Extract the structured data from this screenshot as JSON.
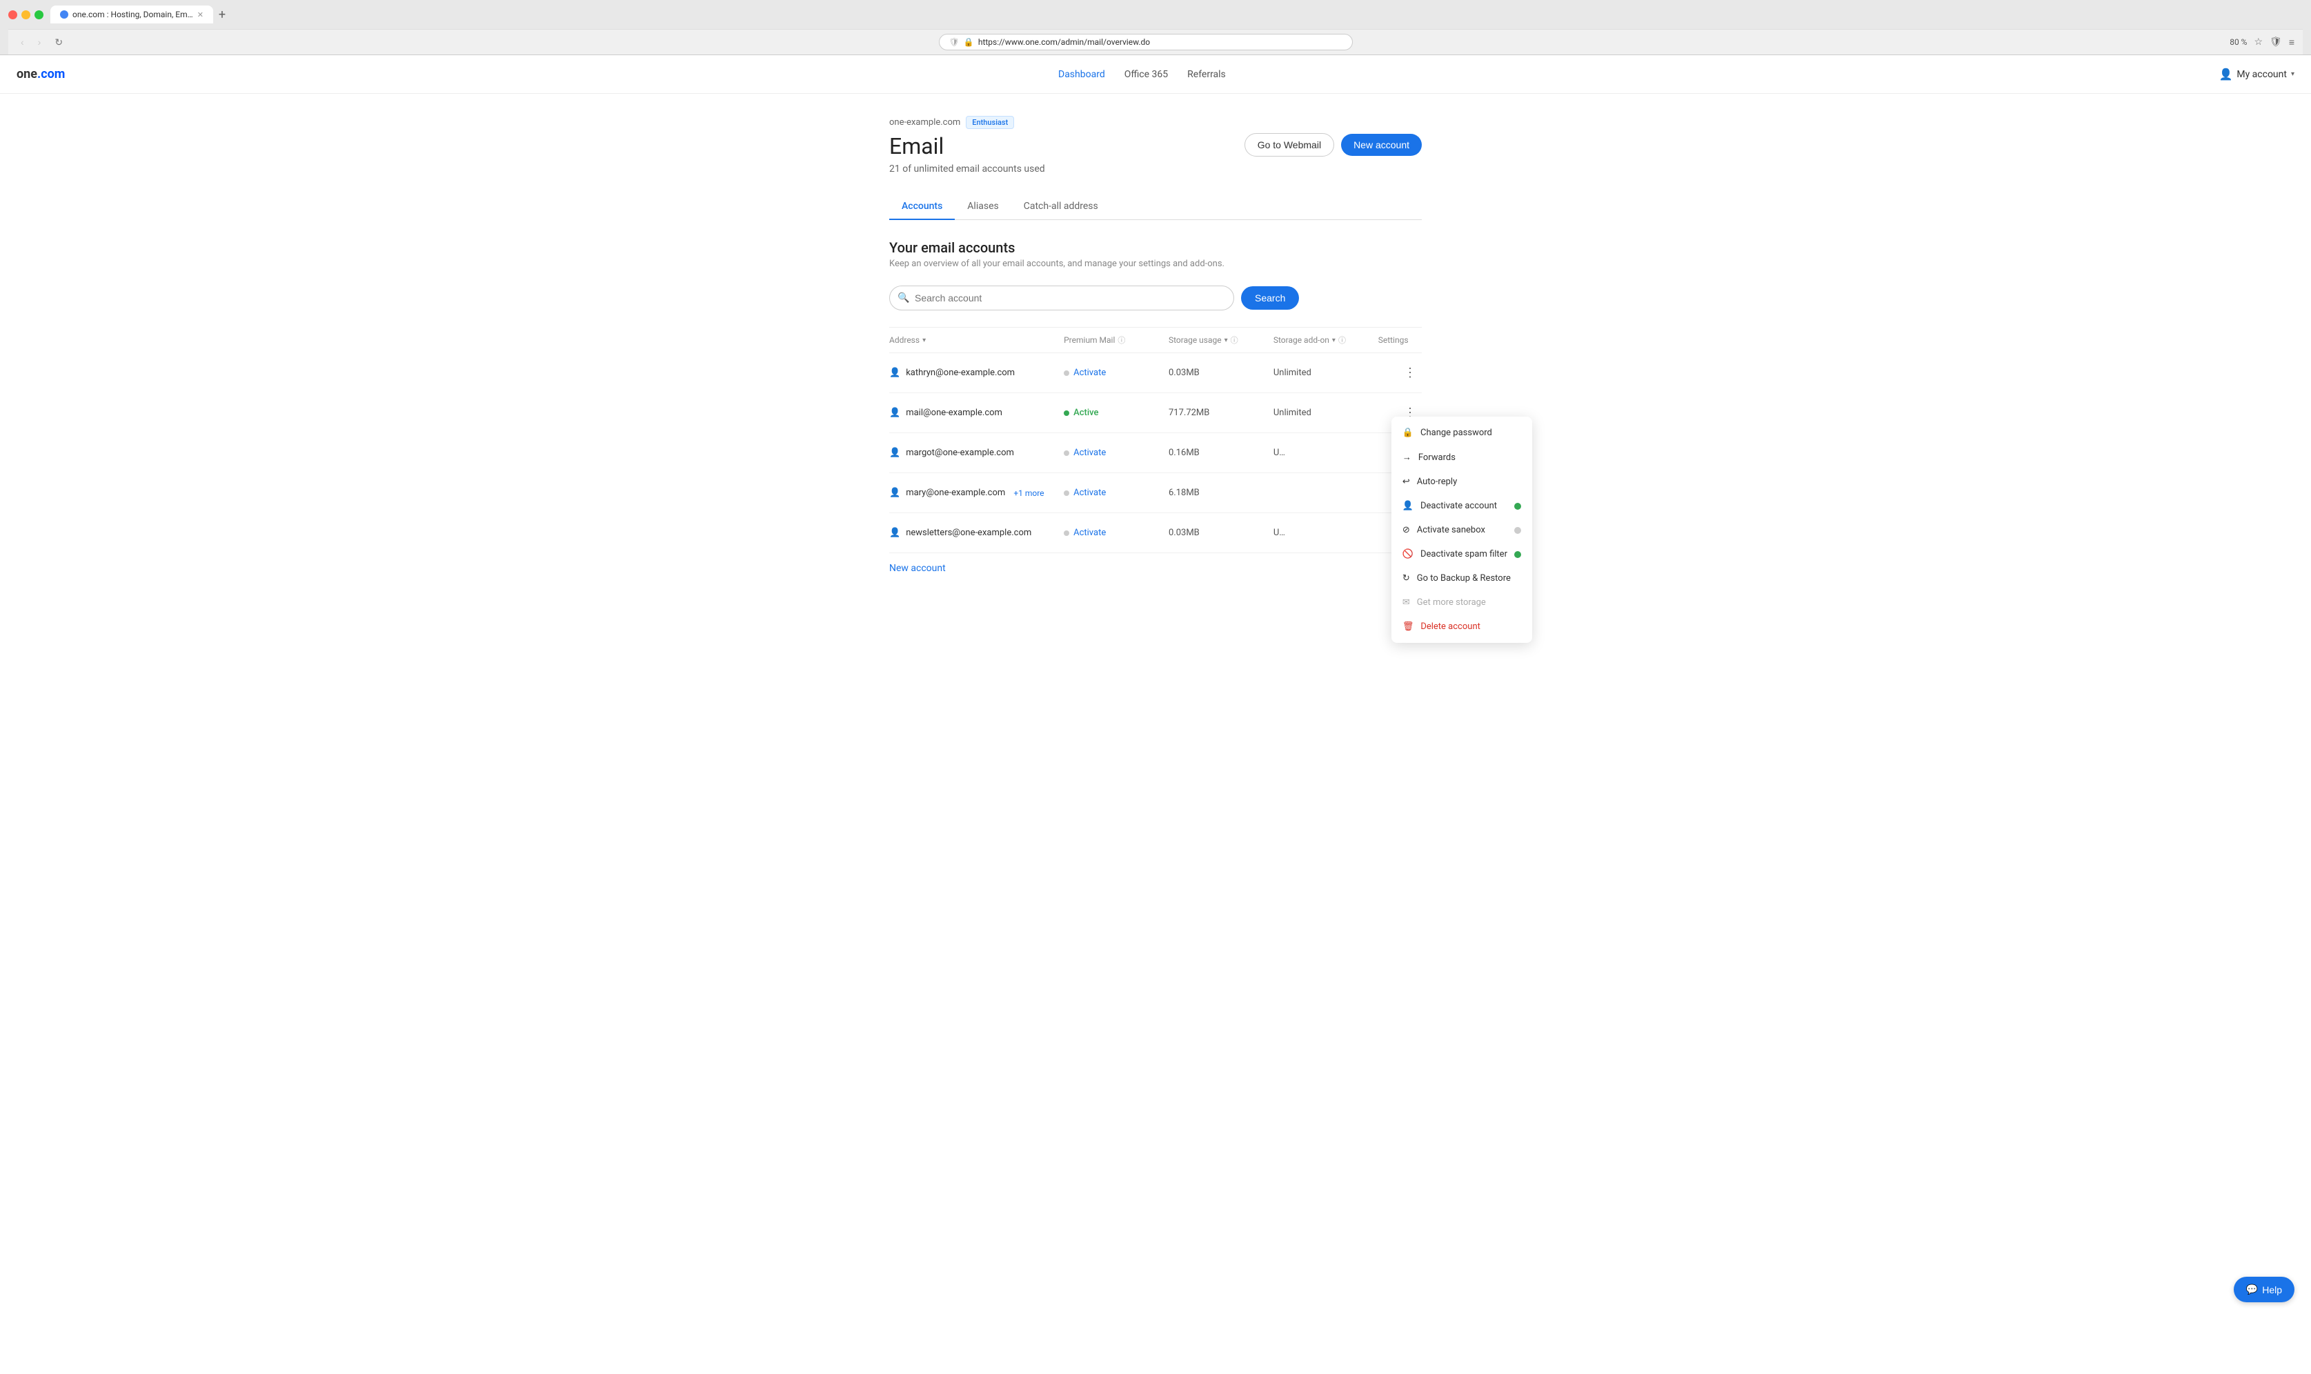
{
  "browser": {
    "tab_title": "one.com : Hosting, Domain, Em…",
    "url": "https://www.one.com/admin/mail/overview.do",
    "zoom": "80 %"
  },
  "nav": {
    "logo": "one.com",
    "links": [
      {
        "label": "Dashboard",
        "active": true
      },
      {
        "label": "Office 365",
        "active": false
      },
      {
        "label": "Referrals",
        "active": false
      }
    ],
    "my_account": "My account"
  },
  "page": {
    "domain": "one-example.com",
    "badge": "Enthusiast",
    "title": "Email",
    "subtitle": "21 of unlimited email accounts used",
    "btn_webmail": "Go to Webmail",
    "btn_new": "New account"
  },
  "tabs": [
    {
      "label": "Accounts",
      "active": true
    },
    {
      "label": "Aliases",
      "active": false
    },
    {
      "label": "Catch-all address",
      "active": false
    }
  ],
  "accounts_section": {
    "title": "Your email accounts",
    "description": "Keep an overview of all your email accounts, and manage your settings and add-ons.",
    "search_placeholder": "Search account",
    "search_btn": "Search"
  },
  "table": {
    "headers": [
      {
        "label": "Address",
        "sortable": true
      },
      {
        "label": "Premium Mail",
        "info": true
      },
      {
        "label": "Storage usage",
        "sortable": true,
        "info": true
      },
      {
        "label": "Storage add-on",
        "sortable": true,
        "info": true
      },
      {
        "label": "Settings"
      }
    ],
    "rows": [
      {
        "email": "kathryn@one-example.com",
        "premium_status": "Activate",
        "premium_active": false,
        "storage": "0.03MB",
        "addon": "Unlimited",
        "menu_open": false
      },
      {
        "email": "mail@one-example.com",
        "premium_status": "Active",
        "premium_active": true,
        "storage": "717.72MB",
        "addon": "Unlimited",
        "menu_open": true
      },
      {
        "email": "margot@one-example.com",
        "premium_status": "Activate",
        "premium_active": false,
        "storage": "0.16MB",
        "addon": "U…",
        "menu_open": false
      },
      {
        "email": "mary@one-example.com",
        "extra": "+1 more",
        "premium_status": "Activate",
        "premium_active": false,
        "storage": "6.18MB",
        "addon": "",
        "menu_open": false
      },
      {
        "email": "newsletters@one-example.com",
        "premium_status": "Activate",
        "premium_active": false,
        "storage": "0.03MB",
        "addon": "U…",
        "menu_open": false
      }
    ],
    "new_account_link": "New account"
  },
  "context_menu": {
    "items": [
      {
        "label": "Change password",
        "icon": "🔒",
        "toggle": null,
        "danger": false,
        "disabled": false
      },
      {
        "label": "Forwards",
        "icon": "→",
        "toggle": null,
        "danger": false,
        "disabled": false
      },
      {
        "label": "Auto-reply",
        "icon": "↩",
        "toggle": null,
        "danger": false,
        "disabled": false
      },
      {
        "label": "Deactivate account",
        "icon": "👤",
        "toggle": "green",
        "danger": false,
        "disabled": false
      },
      {
        "label": "Activate sanebox",
        "icon": "🗑",
        "toggle": "gray",
        "danger": false,
        "disabled": false
      },
      {
        "label": "Deactivate spam filter",
        "icon": "🚫",
        "toggle": "green",
        "danger": false,
        "disabled": false
      },
      {
        "label": "Go to Backup & Restore",
        "icon": "↻",
        "toggle": null,
        "danger": false,
        "disabled": false
      },
      {
        "label": "Get more storage",
        "icon": "✉",
        "toggle": null,
        "danger": false,
        "disabled": true
      },
      {
        "label": "Delete account",
        "icon": "🗑",
        "toggle": null,
        "danger": true,
        "disabled": false
      }
    ]
  },
  "help_btn": "Help"
}
